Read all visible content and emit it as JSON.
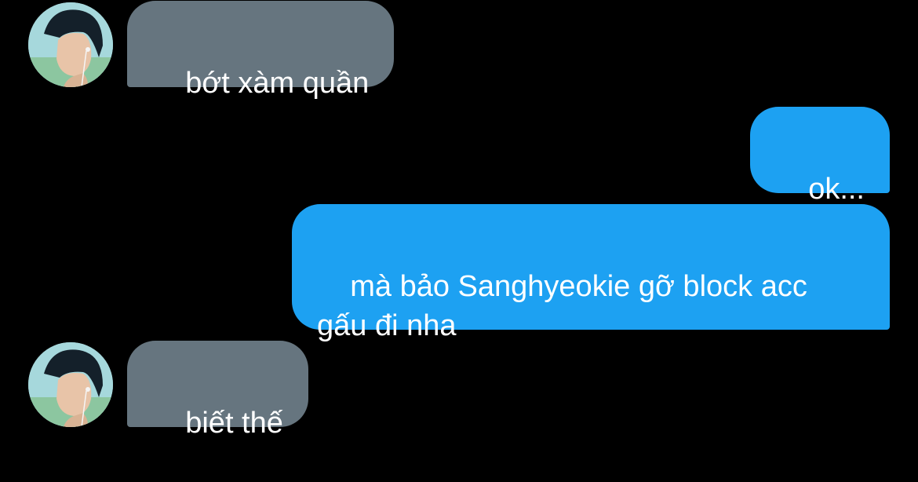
{
  "conversation": {
    "messages": [
      {
        "direction": "incoming",
        "text": "bớt xàm quần",
        "avatar": "profile-photo"
      },
      {
        "direction": "outgoing",
        "text": "ok..."
      },
      {
        "direction": "outgoing",
        "text": "mà bảo Sanghyeokie gỡ block acc\ngấu đi nha"
      },
      {
        "direction": "incoming",
        "text": "biết thế",
        "avatar": "profile-photo"
      }
    ]
  },
  "colors": {
    "background": "#000000",
    "incoming_bubble": "#66757f",
    "outgoing_bubble": "#1da1f2",
    "text": "#ffffff"
  }
}
